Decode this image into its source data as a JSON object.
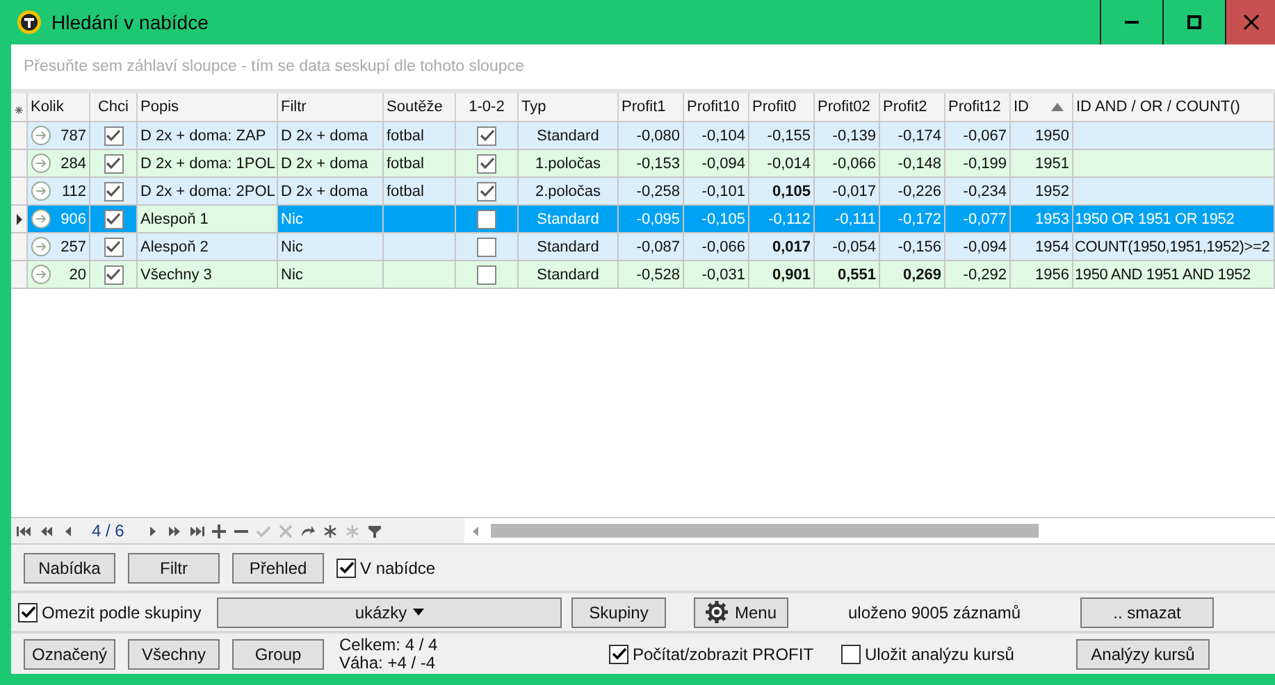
{
  "window": {
    "title": "Hledání v nabídce"
  },
  "group_panel": {
    "hint": "Přesuňte sem záhlaví sloupce - tím se data seskupí dle tohoto sloupce"
  },
  "table": {
    "new_row_marker": "⁕",
    "columns": [
      {
        "label": "Kolik",
        "sorted": false,
        "current": false
      },
      {
        "label": "Chci",
        "sorted": false,
        "current": false
      },
      {
        "label": "Popis",
        "sorted": false,
        "current": true
      },
      {
        "label": "Filtr",
        "sorted": false,
        "current": false
      },
      {
        "label": "Soutěže",
        "sorted": false,
        "current": false
      },
      {
        "label": "1-0-2",
        "sorted": false,
        "current": false
      },
      {
        "label": "Typ",
        "sorted": false,
        "current": false
      },
      {
        "label": "Profit1",
        "sorted": false,
        "current": false
      },
      {
        "label": "Profit10",
        "sorted": false,
        "current": false
      },
      {
        "label": "Profit0",
        "sorted": false,
        "current": false
      },
      {
        "label": "Profit02",
        "sorted": false,
        "current": false
      },
      {
        "label": "Profit2",
        "sorted": false,
        "current": false
      },
      {
        "label": "Profit12",
        "sorted": false,
        "current": false
      },
      {
        "label": "ID",
        "sorted": true,
        "current": false
      },
      {
        "label": "ID AND / OR / COUNT()",
        "sorted": false,
        "current": false
      }
    ],
    "rows": [
      {
        "selected": false,
        "kolik": "787",
        "chci": true,
        "popis": "D 2x + doma: ZAP",
        "filtr": "D 2x + doma",
        "souteze": "fotbal",
        "x102": true,
        "typ": "Standard",
        "profits": [
          {
            "value": "-0,080",
            "bold": false
          },
          {
            "value": "-0,104",
            "bold": false
          },
          {
            "value": "-0,155",
            "bold": false
          },
          {
            "value": "-0,139",
            "bold": false
          },
          {
            "value": "-0,174",
            "bold": false
          },
          {
            "value": "-0,067",
            "bold": false
          }
        ],
        "id": "1950"
      },
      {
        "selected": false,
        "kolik": "284",
        "chci": true,
        "popis": "D 2x + doma: 1POL",
        "filtr": "D 2x + doma",
        "souteze": "fotbal",
        "x102": true,
        "typ": "1.poločas",
        "profits": [
          {
            "value": "-0,153",
            "bold": false
          },
          {
            "value": "-0,094",
            "bold": false
          },
          {
            "value": "-0,014",
            "bold": false
          },
          {
            "value": "-0,066",
            "bold": false
          },
          {
            "value": "-0,148",
            "bold": false
          },
          {
            "value": "-0,199",
            "bold": false
          }
        ],
        "id": "1951"
      },
      {
        "selected": false,
        "kolik": "112",
        "chci": true,
        "popis": "D 2x + doma: 2POL",
        "filtr": "D 2x + doma",
        "souteze": "fotbal",
        "x102": true,
        "typ": "2.poločas",
        "profits": [
          {
            "value": "-0,258",
            "bold": false
          },
          {
            "value": "-0,101",
            "bold": false
          },
          {
            "value": "0,105",
            "bold": true
          },
          {
            "value": "-0,017",
            "bold": false
          },
          {
            "value": "-0,226",
            "bold": false
          },
          {
            "value": "-0,234",
            "bold": false
          }
        ],
        "id": "1952"
      },
      {
        "selected": true,
        "kolik": "906",
        "chci": true,
        "popis": "Alespoň 1",
        "filtr": "Nic",
        "x102": false,
        "typ": "Standard",
        "profits": [
          {
            "value": "-0,095",
            "bold": false
          },
          {
            "value": "-0,105",
            "bold": false
          },
          {
            "value": "-0,112",
            "bold": false
          },
          {
            "value": "-0,111",
            "bold": false
          },
          {
            "value": "-0,172",
            "bold": false
          },
          {
            "value": "-0,077",
            "bold": false
          }
        ],
        "id": "1953",
        "expr": "1950 OR 1951 OR 1952"
      },
      {
        "selected": false,
        "kolik": "257",
        "chci": true,
        "popis": "Alespoň 2",
        "filtr": "Nic",
        "x102": false,
        "typ": "Standard",
        "profits": [
          {
            "value": "-0,087",
            "bold": false
          },
          {
            "value": "-0,066",
            "bold": false
          },
          {
            "value": "0,017",
            "bold": true
          },
          {
            "value": "-0,054",
            "bold": false
          },
          {
            "value": "-0,156",
            "bold": false
          },
          {
            "value": "-0,094",
            "bold": false
          }
        ],
        "id": "1954",
        "expr": "COUNT(1950,1951,1952)>=2"
      },
      {
        "selected": false,
        "kolik": "20",
        "chci": true,
        "popis": "Všechny 3",
        "filtr": "Nic",
        "x102": false,
        "typ": "Standard",
        "profits": [
          {
            "value": "-0,528",
            "bold": false
          },
          {
            "value": "-0,031",
            "bold": false
          },
          {
            "value": "0,901",
            "bold": true
          },
          {
            "value": "0,551",
            "bold": true
          },
          {
            "value": "0,269",
            "bold": true
          },
          {
            "value": "-0,292",
            "bold": false
          }
        ],
        "id": "1956",
        "expr": "1950 AND 1951 AND 1952"
      }
    ]
  },
  "navigator": {
    "position": "4 / 6",
    "buttons": [
      {
        "kind": "first",
        "disabled": false
      },
      {
        "kind": "prev-page",
        "disabled": false
      },
      {
        "kind": "prev",
        "disabled": false
      },
      {
        "kind": "position"
      },
      {
        "kind": "next",
        "disabled": false
      },
      {
        "kind": "next-page",
        "disabled": false
      },
      {
        "kind": "last",
        "disabled": false
      },
      {
        "kind": "add",
        "disabled": false
      },
      {
        "kind": "remove",
        "disabled": false
      },
      {
        "kind": "confirm",
        "disabled": true
      },
      {
        "kind": "cancel",
        "disabled": true
      },
      {
        "kind": "refresh",
        "disabled": false
      },
      {
        "kind": "star",
        "disabled": false
      },
      {
        "kind": "star",
        "disabled": true
      },
      {
        "kind": "filter",
        "disabled": false
      }
    ]
  },
  "row1": {
    "buttons": [
      "Nabídka",
      "Filtr",
      "Přehled"
    ],
    "checkbox": {
      "label": "V nabídce",
      "checked": true
    }
  },
  "row2": {
    "checkbox": {
      "label": "Omezit podle skupiny",
      "checked": true
    },
    "dropdown": "ukázky",
    "groups_button": "Skupiny",
    "menu_button": "Menu",
    "status": "uloženo 9005 záznamů",
    "delete_button": ".. smazat"
  },
  "row3": {
    "buttons": [
      "Označený",
      "Všechny",
      "Group"
    ],
    "totals": [
      "Celkem: 4 / 4",
      "Váha: +4 / -4"
    ],
    "profit_checkbox": {
      "label": "Počítat/zobrazit PROFIT",
      "checked": true
    },
    "save_checkbox": {
      "label": "Uložit analýzu kursů",
      "checked": false
    },
    "analysis_button": "Analýzy kursů"
  }
}
